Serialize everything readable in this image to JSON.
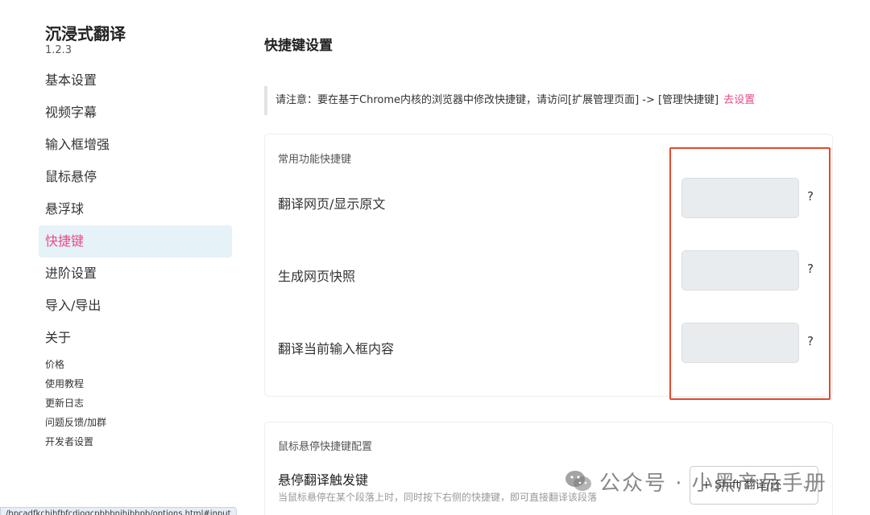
{
  "app": {
    "title": "沉浸式翻译",
    "version": "1.2.3"
  },
  "sidebar": {
    "items": [
      {
        "label": "基本设置"
      },
      {
        "label": "视频字幕"
      },
      {
        "label": "输入框增强"
      },
      {
        "label": "鼠标悬停"
      },
      {
        "label": "悬浮球"
      },
      {
        "label": "快捷键",
        "active": true
      },
      {
        "label": "进阶设置"
      },
      {
        "label": "导入/导出"
      },
      {
        "label": "关于"
      }
    ],
    "subitems": [
      {
        "label": "价格"
      },
      {
        "label": "使用教程"
      },
      {
        "label": "更新日志"
      },
      {
        "label": "问题反馈/加群"
      },
      {
        "label": "开发者设置"
      }
    ]
  },
  "main": {
    "title": "快捷键设置",
    "notice": {
      "text": "请注意：要在基于Chrome内核的浏览器中修改快捷键，请访问[扩展管理页面] -> [管理快捷键]",
      "link": "去设置"
    },
    "common_shortcuts": {
      "heading": "常用功能快捷键",
      "rows": [
        {
          "label": "翻译网页/显示原文",
          "value": "",
          "help": "?"
        },
        {
          "label": "生成网页快照",
          "value": "",
          "help": "?"
        },
        {
          "label": "翻译当前输入框内容",
          "value": "",
          "help": "?"
        }
      ]
    },
    "hover_shortcuts": {
      "heading": "鼠标悬停快捷键配置",
      "trigger_label": "悬停翻译触发键",
      "trigger_desc": "当鼠标悬停在某个段落上时，同时按下右侧的快捷键，即可直接翻译该段落",
      "trigger_value": "+ Shift 翻译/还"
    }
  },
  "watermark": {
    "text": "公众号 · 小黑产品手册"
  },
  "status_bar": {
    "url": "/hpcadfkchihfbfcdiogcpbhbnihibhpb/options.html#input"
  },
  "colors": {
    "accent": "#ea4c89",
    "active_bg": "#e5f2f8",
    "highlight": "#e8472d"
  }
}
